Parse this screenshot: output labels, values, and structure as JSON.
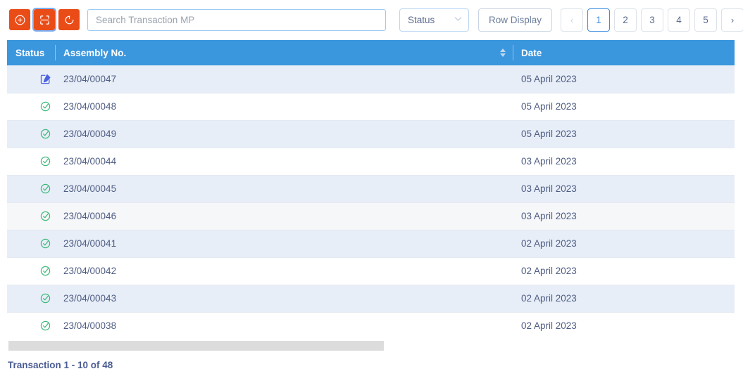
{
  "toolbar": {
    "buttons": [
      {
        "name": "add-transaction-button",
        "icon": "plus-circle-icon",
        "title": "Add"
      },
      {
        "name": "scan-button",
        "icon": "scan-icon",
        "title": "Scan"
      },
      {
        "name": "refresh-button",
        "icon": "refresh-icon",
        "title": "Refresh"
      }
    ],
    "search": {
      "value": "",
      "placeholder": "Search Transaction MP"
    },
    "status_filter": {
      "label": "Status",
      "chevron": "∨"
    },
    "row_display_label": "Row Display"
  },
  "pagination": {
    "prev_label": "‹",
    "next_label": "›",
    "pages": [
      "1",
      "2",
      "3",
      "4",
      "5"
    ],
    "active_page": "1"
  },
  "table": {
    "columns": [
      {
        "key": "status",
        "label": "Status"
      },
      {
        "key": "assembly",
        "label": "Assembly No."
      },
      {
        "key": "date",
        "label": "Date"
      }
    ],
    "sort_column": "assembly",
    "rows": [
      {
        "status_icon": "edit-icon",
        "status_kind": "edit",
        "assembly": "23/04/00047",
        "date": "05 April 2023",
        "shade": "odd"
      },
      {
        "status_icon": "check-circle-icon",
        "status_kind": "complete",
        "assembly": "23/04/00048",
        "date": "05 April 2023",
        "shade": "even"
      },
      {
        "status_icon": "check-circle-icon",
        "status_kind": "complete",
        "assembly": "23/04/00049",
        "date": "05 April 2023",
        "shade": "odd"
      },
      {
        "status_icon": "check-circle-icon",
        "status_kind": "complete",
        "assembly": "23/04/00044",
        "date": "03 April 2023",
        "shade": "even"
      },
      {
        "status_icon": "check-circle-icon",
        "status_kind": "complete",
        "assembly": "23/04/00045",
        "date": "03 April 2023",
        "shade": "odd"
      },
      {
        "status_icon": "check-circle-icon",
        "status_kind": "complete",
        "assembly": "23/04/00046",
        "date": "03 April 2023",
        "shade": "hover"
      },
      {
        "status_icon": "check-circle-icon",
        "status_kind": "complete",
        "assembly": "23/04/00041",
        "date": "02 April 2023",
        "shade": "odd"
      },
      {
        "status_icon": "check-circle-icon",
        "status_kind": "complete",
        "assembly": "23/04/00042",
        "date": "02 April 2023",
        "shade": "even"
      },
      {
        "status_icon": "check-circle-icon",
        "status_kind": "complete",
        "assembly": "23/04/00043",
        "date": "02 April 2023",
        "shade": "odd"
      },
      {
        "status_icon": "check-circle-icon",
        "status_kind": "complete",
        "assembly": "23/04/00038",
        "date": "02 April 2023",
        "shade": "even"
      }
    ]
  },
  "footer": {
    "summary": "Transaction 1 - 10 of 48"
  },
  "colors": {
    "accent_orange": "#ea4c18",
    "header_blue": "#3a96dd",
    "row_alt_blue": "#e7eef8",
    "text_navy": "#4f5d83",
    "status_green": "#3cb878",
    "status_edit_blue": "#4b61e0",
    "scrollbar_gray": "#dcdcdc"
  }
}
